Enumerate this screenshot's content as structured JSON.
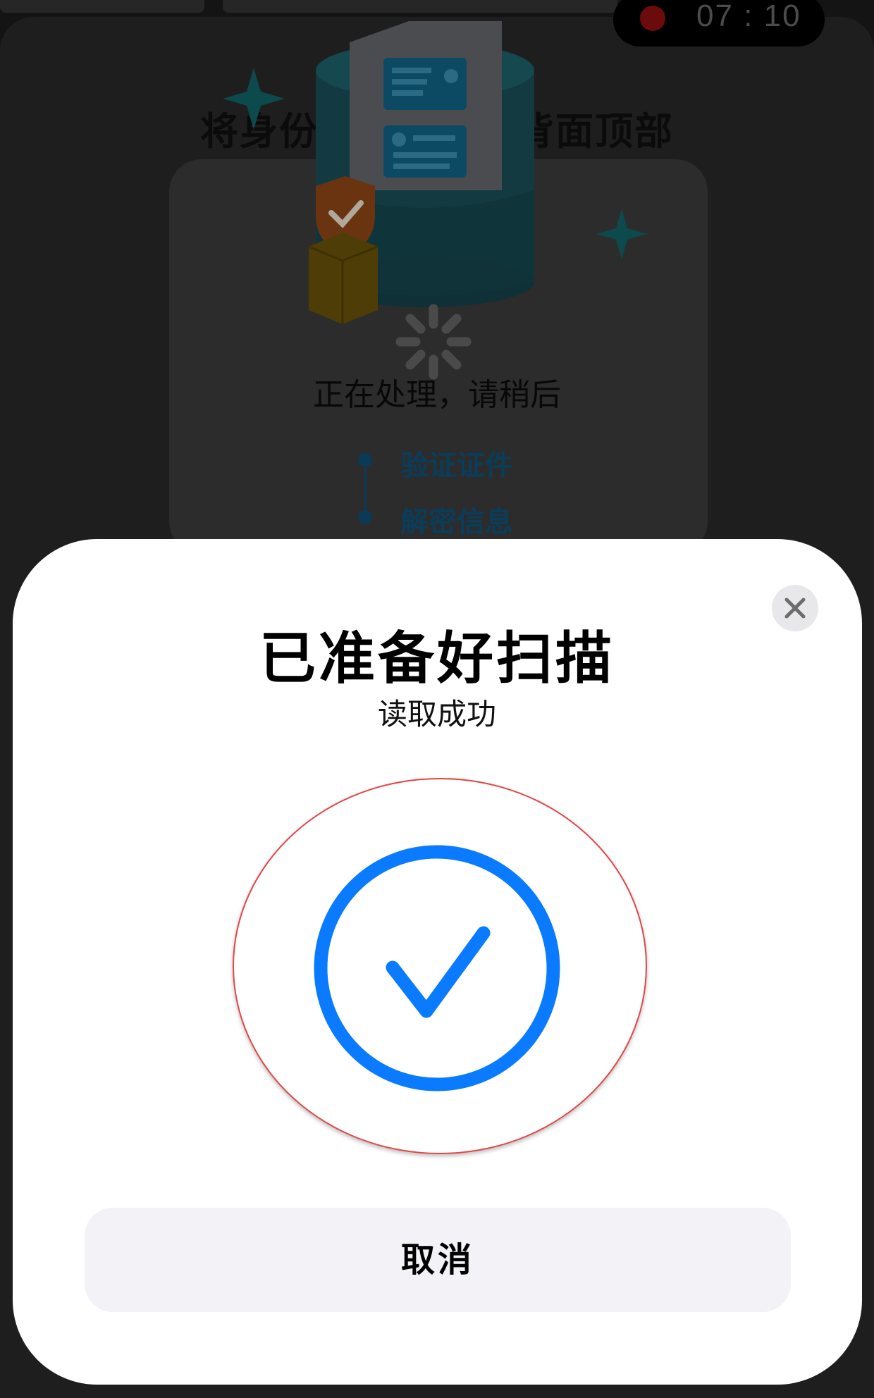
{
  "status_bar": {
    "recording_time": "07 : 10"
  },
  "background": {
    "title": "将身份证放在手机背面顶部",
    "processing_text": "正在处理，请稍后",
    "steps": [
      {
        "label": "验证证件"
      },
      {
        "label": "解密信息"
      }
    ]
  },
  "sheet": {
    "title": "已准备好扫描",
    "subtitle": "读取成功",
    "cancel_label": "取消"
  },
  "colors": {
    "accent_blue": "#0a7aff",
    "highlight_red": "#e24646",
    "sheet_background": "#ffffff",
    "button_background": "#f2f2f7"
  },
  "icons": [
    "recording-dot-icon",
    "id-card-illustration",
    "loading-spinner-icon",
    "close-icon",
    "success-check-icon"
  ]
}
